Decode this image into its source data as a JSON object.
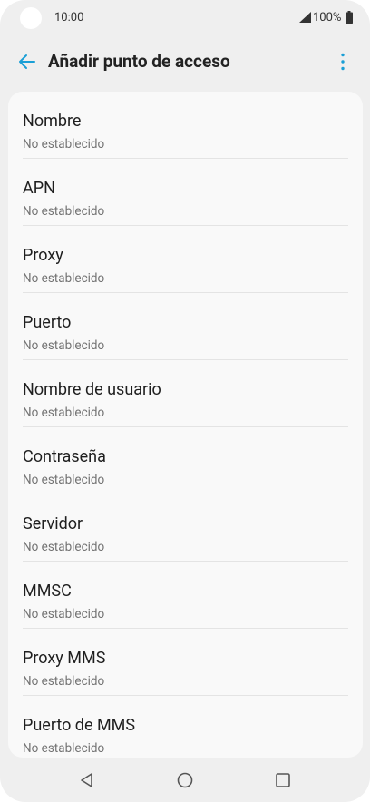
{
  "status_bar": {
    "time": "10:00",
    "battery_percent": "100%",
    "signal_icon": "cell-signal-icon",
    "battery_icon": "battery-full-icon"
  },
  "header": {
    "title": "Añadir punto de acceso",
    "back_icon": "arrow-back-icon",
    "menu_icon": "more-vert-icon"
  },
  "colors": {
    "accent": "#1a9fd6",
    "background": "#efefef",
    "card": "#f9f9f9"
  },
  "settings": [
    {
      "label": "Nombre",
      "value": "No establecido"
    },
    {
      "label": "APN",
      "value": "No establecido"
    },
    {
      "label": "Proxy",
      "value": "No establecido"
    },
    {
      "label": "Puerto",
      "value": "No establecido"
    },
    {
      "label": "Nombre de usuario",
      "value": "No establecido"
    },
    {
      "label": "Contraseña",
      "value": "No establecido"
    },
    {
      "label": "Servidor",
      "value": "No establecido"
    },
    {
      "label": "MMSC",
      "value": "No establecido"
    },
    {
      "label": "Proxy MMS",
      "value": "No establecido"
    },
    {
      "label": "Puerto de MMS",
      "value": "No establecido"
    }
  ],
  "nav_bar": {
    "back": "nav-back-icon",
    "home": "nav-home-icon",
    "recents": "nav-recents-icon"
  }
}
